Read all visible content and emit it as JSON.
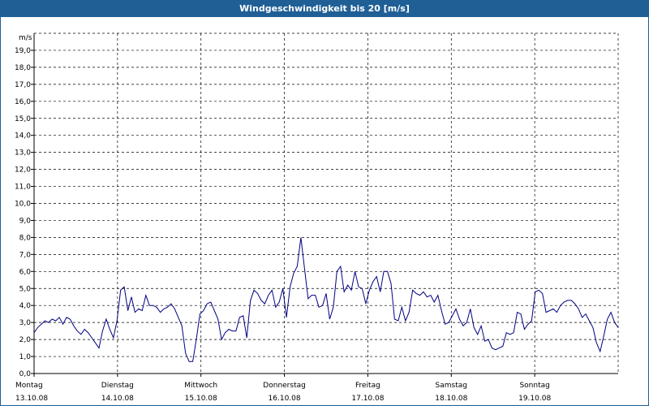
{
  "window": {
    "title": "Windgeschwindigkeit bis 20 [m/s]"
  },
  "colors": {
    "title_bar": "#1f5f96",
    "series": "#000080",
    "grid": "#000000"
  },
  "chart_data": {
    "type": "line",
    "title": "Windgeschwindigkeit bis 20 [m/s]",
    "ylabel": "m/s",
    "ylim": [
      0,
      20
    ],
    "xlim": [
      0,
      7
    ],
    "grid": true,
    "yticks": [
      "0,0",
      "1,0",
      "2,0",
      "3,0",
      "4,0",
      "5,0",
      "6,0",
      "7,0",
      "8,0",
      "9,0",
      "10,0",
      "11,0",
      "12,0",
      "13,0",
      "14,0",
      "15,0",
      "16,0",
      "17,0",
      "18,0",
      "19,0"
    ],
    "day_labels": [
      {
        "day": "Montag",
        "date": "13.10.08"
      },
      {
        "day": "Dienstag",
        "date": "14.10.08"
      },
      {
        "day": "Mittwoch",
        "date": "15.10.08"
      },
      {
        "day": "Donnerstag",
        "date": "16.10.08"
      },
      {
        "day": "Freitag",
        "date": "17.10.08"
      },
      {
        "day": "Samstag",
        "date": "18.10.08"
      },
      {
        "day": "Sonntag",
        "date": "19.10.08"
      }
    ],
    "series": [
      {
        "values": [
          2.4,
          2.7,
          2.9,
          3.1,
          3.0,
          3.2,
          3.1,
          3.3,
          2.9,
          3.3,
          3.2,
          2.8,
          2.5,
          2.3,
          2.6,
          2.4,
          2.1,
          1.8,
          1.5,
          2.5,
          3.2,
          2.6,
          2.1,
          3.1,
          4.9,
          5.1,
          3.7,
          4.5,
          3.6,
          3.8,
          3.7,
          4.6,
          4.0,
          4.0,
          3.9,
          3.6,
          3.8,
          3.9,
          4.1,
          3.8,
          3.3,
          2.8,
          1.2,
          0.7,
          0.7,
          2.0,
          3.5,
          3.7,
          4.1,
          4.2,
          3.7,
          3.2,
          2.0,
          2.4,
          2.6,
          2.5,
          2.5,
          3.3,
          3.4,
          2.1,
          4.3,
          4.9,
          4.7,
          4.3,
          4.1,
          4.6,
          4.9,
          3.9,
          4.2,
          5.0,
          3.3,
          5.1,
          5.9,
          6.3,
          8.0,
          6.2,
          4.4,
          4.6,
          4.6,
          3.9,
          4.0,
          4.7,
          3.2,
          3.9,
          6.0,
          6.3,
          4.8,
          5.2,
          4.9,
          6.0,
          5.1,
          5.0,
          4.1,
          4.9,
          5.4,
          5.7,
          4.8,
          6.0,
          6.0,
          5.3,
          3.2,
          3.1,
          3.9,
          3.1,
          3.6,
          4.9,
          4.7,
          4.6,
          4.8,
          4.5,
          4.6,
          4.2,
          4.6,
          3.7,
          2.9,
          3.0,
          3.4,
          3.8,
          3.2,
          2.8,
          3.0,
          3.8,
          2.7,
          2.3,
          2.8,
          1.9,
          2.0,
          1.5,
          1.4,
          1.5,
          1.6,
          2.4,
          2.3,
          2.4,
          3.6,
          3.5,
          2.6,
          2.9,
          3.1,
          4.8,
          4.9,
          4.7,
          3.6,
          3.7,
          3.8,
          3.6,
          4.0,
          4.2,
          4.3,
          4.3,
          4.1,
          3.8,
          3.3,
          3.5,
          3.1,
          2.7,
          1.8,
          1.3,
          2.2,
          3.2,
          3.6,
          3.0,
          2.7
        ]
      }
    ]
  }
}
